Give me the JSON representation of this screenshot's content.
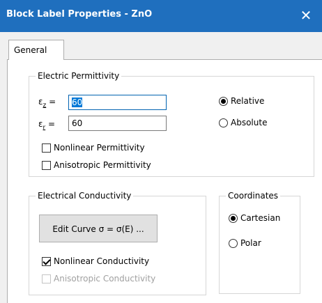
{
  "window": {
    "title": "Block Label Properties - ZnO",
    "close_glyph": "✕"
  },
  "tabs": [
    {
      "label": "General"
    }
  ],
  "electric_permittivity": {
    "label": "Electric Permittivity",
    "eps_z_symbol": "ε",
    "eps_z_sub": "z",
    "eps_z_value": "60",
    "eps_r_symbol": "ε",
    "eps_r_sub": "r",
    "eps_r_value": "60",
    "equals": "=",
    "relative_label": "Relative",
    "absolute_label": "Absolute",
    "nonlinear_label": "Nonlinear Permittivity",
    "anisotropic_label": "Anisotropic Permittivity",
    "relative_selected": true,
    "nonlinear_checked": false,
    "anisotropic_checked": false
  },
  "electrical_conductivity": {
    "label": "Electrical Conductivity",
    "edit_curve_button": "Edit Curve σ = σ(E) ...",
    "nonlinear_label": "Nonlinear Conductivity",
    "anisotropic_label": "Anisotropic Conductivity",
    "nonlinear_checked": true,
    "anisotropic_checked": false,
    "anisotropic_disabled": true
  },
  "coordinates": {
    "label": "Coordinates",
    "cartesian_label": "Cartesian",
    "polar_label": "Polar",
    "cartesian_selected": true
  },
  "colors": {
    "titlebar": "#1f6fbe",
    "selection": "#0078d7",
    "disabled_text": "#a0a0a0"
  }
}
